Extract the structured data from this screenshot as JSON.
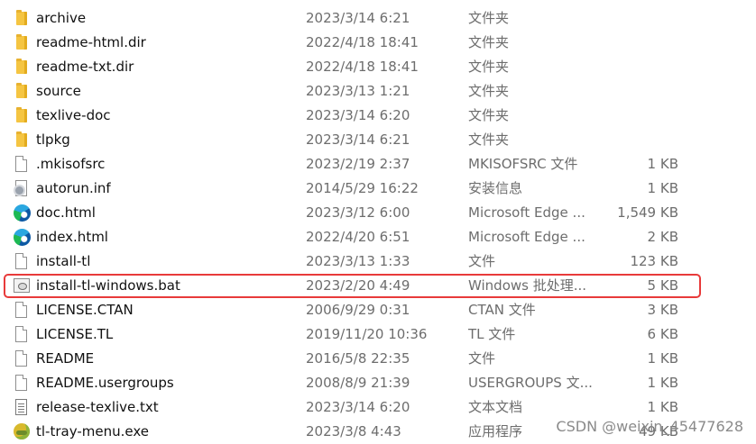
{
  "files": [
    {
      "name": "archive",
      "date": "2023/3/14 6:21",
      "type": "文件夹",
      "size": "",
      "icon": "folder-icon"
    },
    {
      "name": "readme-html.dir",
      "date": "2022/4/18 18:41",
      "type": "文件夹",
      "size": "",
      "icon": "folder-icon"
    },
    {
      "name": "readme-txt.dir",
      "date": "2022/4/18 18:41",
      "type": "文件夹",
      "size": "",
      "icon": "folder-icon"
    },
    {
      "name": "source",
      "date": "2023/3/13 1:21",
      "type": "文件夹",
      "size": "",
      "icon": "folder-icon"
    },
    {
      "name": "texlive-doc",
      "date": "2023/3/14 6:20",
      "type": "文件夹",
      "size": "",
      "icon": "folder-icon"
    },
    {
      "name": "tlpkg",
      "date": "2023/3/14 6:21",
      "type": "文件夹",
      "size": "",
      "icon": "folder-icon"
    },
    {
      "name": ".mkisofsrc",
      "date": "2023/2/19 2:37",
      "type": "MKISOFSRC 文件",
      "size": "1 KB",
      "icon": "file-icon"
    },
    {
      "name": "autorun.inf",
      "date": "2014/5/29 16:22",
      "type": "安装信息",
      "size": "1 KB",
      "icon": "settings-file-icon"
    },
    {
      "name": "doc.html",
      "date": "2023/3/12 6:00",
      "type": "Microsoft Edge ...",
      "size": "1,549 KB",
      "icon": "edge-icon"
    },
    {
      "name": "index.html",
      "date": "2022/4/20 6:51",
      "type": "Microsoft Edge ...",
      "size": "2 KB",
      "icon": "edge-icon"
    },
    {
      "name": "install-tl",
      "date": "2023/3/13 1:33",
      "type": "文件",
      "size": "123 KB",
      "icon": "file-icon"
    },
    {
      "name": "install-tl-windows.bat",
      "date": "2023/2/20 4:49",
      "type": "Windows 批处理...",
      "size": "5 KB",
      "icon": "batch-file-icon"
    },
    {
      "name": "LICENSE.CTAN",
      "date": "2006/9/29 0:31",
      "type": "CTAN 文件",
      "size": "3 KB",
      "icon": "file-icon"
    },
    {
      "name": "LICENSE.TL",
      "date": "2019/11/20 10:36",
      "type": "TL 文件",
      "size": "6 KB",
      "icon": "file-icon"
    },
    {
      "name": "README",
      "date": "2016/5/8 22:35",
      "type": "文件",
      "size": "1 KB",
      "icon": "file-icon"
    },
    {
      "name": "README.usergroups",
      "date": "2008/8/9 21:39",
      "type": "USERGROUPS 文...",
      "size": "1 KB",
      "icon": "file-icon"
    },
    {
      "name": "release-texlive.txt",
      "date": "2023/3/14 6:20",
      "type": "文本文档",
      "size": "1 KB",
      "icon": "text-document-icon"
    },
    {
      "name": "tl-tray-menu.exe",
      "date": "2023/3/8 4:43",
      "type": "应用程序",
      "size": "49 KB",
      "icon": "application-icon"
    }
  ],
  "watermark": "CSDN @weixin_45477628",
  "colors": {
    "highlight": "#e83a3a",
    "folder": "#f5c542"
  }
}
